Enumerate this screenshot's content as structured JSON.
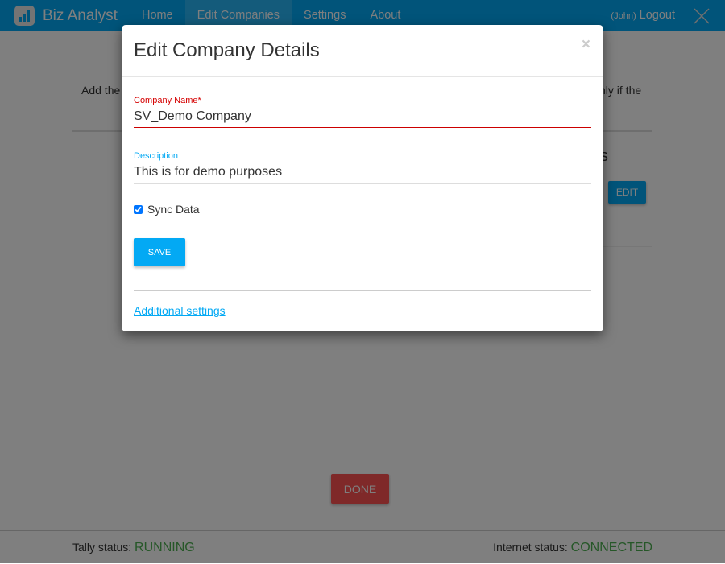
{
  "navbar": {
    "brand": "Biz Analyst",
    "items": [
      {
        "label": "Home"
      },
      {
        "label": "Edit Companies",
        "active": true
      },
      {
        "label": "Settings"
      },
      {
        "label": "About"
      }
    ],
    "user": "(John)",
    "logout": "Logout",
    "primary_color": "#03a9f4"
  },
  "page": {
    "intro_left": "Add the",
    "intro_right": "nly if the",
    "heading_fragment": "s",
    "edit_label": "EDIT",
    "done_label": "DONE"
  },
  "footer": {
    "tally_label": "Tally status:",
    "tally_value": "RUNNING",
    "internet_label": "Internet status:",
    "internet_value": "CONNECTED"
  },
  "modal": {
    "title": "Edit Company Details",
    "close": "×",
    "company_name_label": "Company Name*",
    "company_name_value": "SV_Demo Company",
    "description_label": "Description",
    "description_value": "This is for demo purposes",
    "sync_label": "Sync Data",
    "sync_checked": true,
    "save_label": "SAVE",
    "additional_settings": "Additional settings",
    "error_color": "#d50000",
    "accent_color": "#03a9f4"
  }
}
